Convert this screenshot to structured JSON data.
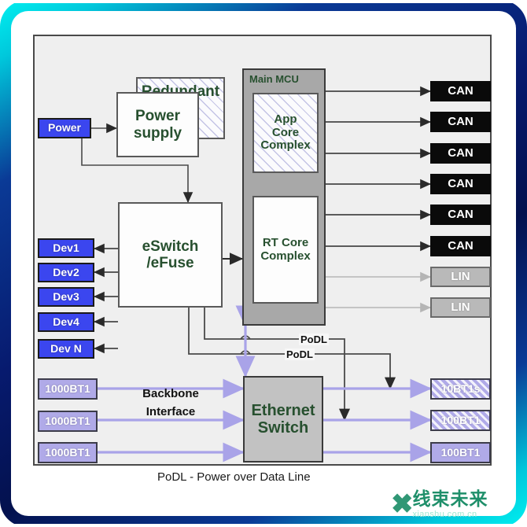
{
  "diagram": {
    "caption": "PoDL - Power over Data Line",
    "backbone_label_line1": "Backbone",
    "backbone_label_line2": "Interface",
    "podl_label_top": "PoDL",
    "podl_label_bottom": "PoDL"
  },
  "power": {
    "source_label": "Power",
    "supply_label": "Power\nsupply",
    "supply_line1": "Power",
    "supply_line2": "supply",
    "redundant_label": "Redundant"
  },
  "eswitch": {
    "line1": "eSwitch",
    "line2": "/eFuse"
  },
  "devices": [
    {
      "label": "Dev1"
    },
    {
      "label": "Dev2"
    },
    {
      "label": "Dev3"
    },
    {
      "label": "Dev4"
    },
    {
      "label": "Dev N"
    }
  ],
  "mcu": {
    "title": "Main MCU",
    "app_core": {
      "line1": "App",
      "line2": "Core",
      "line3": "Complex"
    },
    "rt_core": {
      "line1": "RT Core",
      "line2": "Complex"
    }
  },
  "buses": [
    {
      "label": "CAN",
      "type": "can"
    },
    {
      "label": "CAN",
      "type": "can"
    },
    {
      "label": "CAN",
      "type": "can"
    },
    {
      "label": "CAN",
      "type": "can"
    },
    {
      "label": "CAN",
      "type": "can"
    },
    {
      "label": "CAN",
      "type": "can"
    },
    {
      "label": "LIN",
      "type": "lin"
    },
    {
      "label": "LIN",
      "type": "lin"
    }
  ],
  "ethernet_switch": {
    "line1": "Ethernet",
    "line2": "Switch"
  },
  "backbone_ports": [
    {
      "label": "1000BT1"
    },
    {
      "label": "1000BT1"
    },
    {
      "label": "1000BT1"
    }
  ],
  "edge_ports": [
    {
      "label": "10BT1s",
      "hatched": true
    },
    {
      "label": "100BT1",
      "hatched": true
    },
    {
      "label": "100BT1",
      "hatched": false
    }
  ],
  "watermark": {
    "mark": "✖",
    "brand": "线束未来",
    "url": "xianshu.com.cn"
  },
  "colors": {
    "chip_blue": "#3b46ef",
    "chip_can": "#0a0a0a",
    "chip_lin": "#b9b9b9",
    "chip_eth": "#b0aae8",
    "block_text_green": "#27502f",
    "canvas_bg": "#efefef",
    "frame_cyan": "#00f0f0",
    "frame_navy": "#03114e",
    "arrow_purple": "#a9a3e8",
    "arrow_dark": "#2a2a2a",
    "arrow_gray": "#b5b5b5"
  }
}
